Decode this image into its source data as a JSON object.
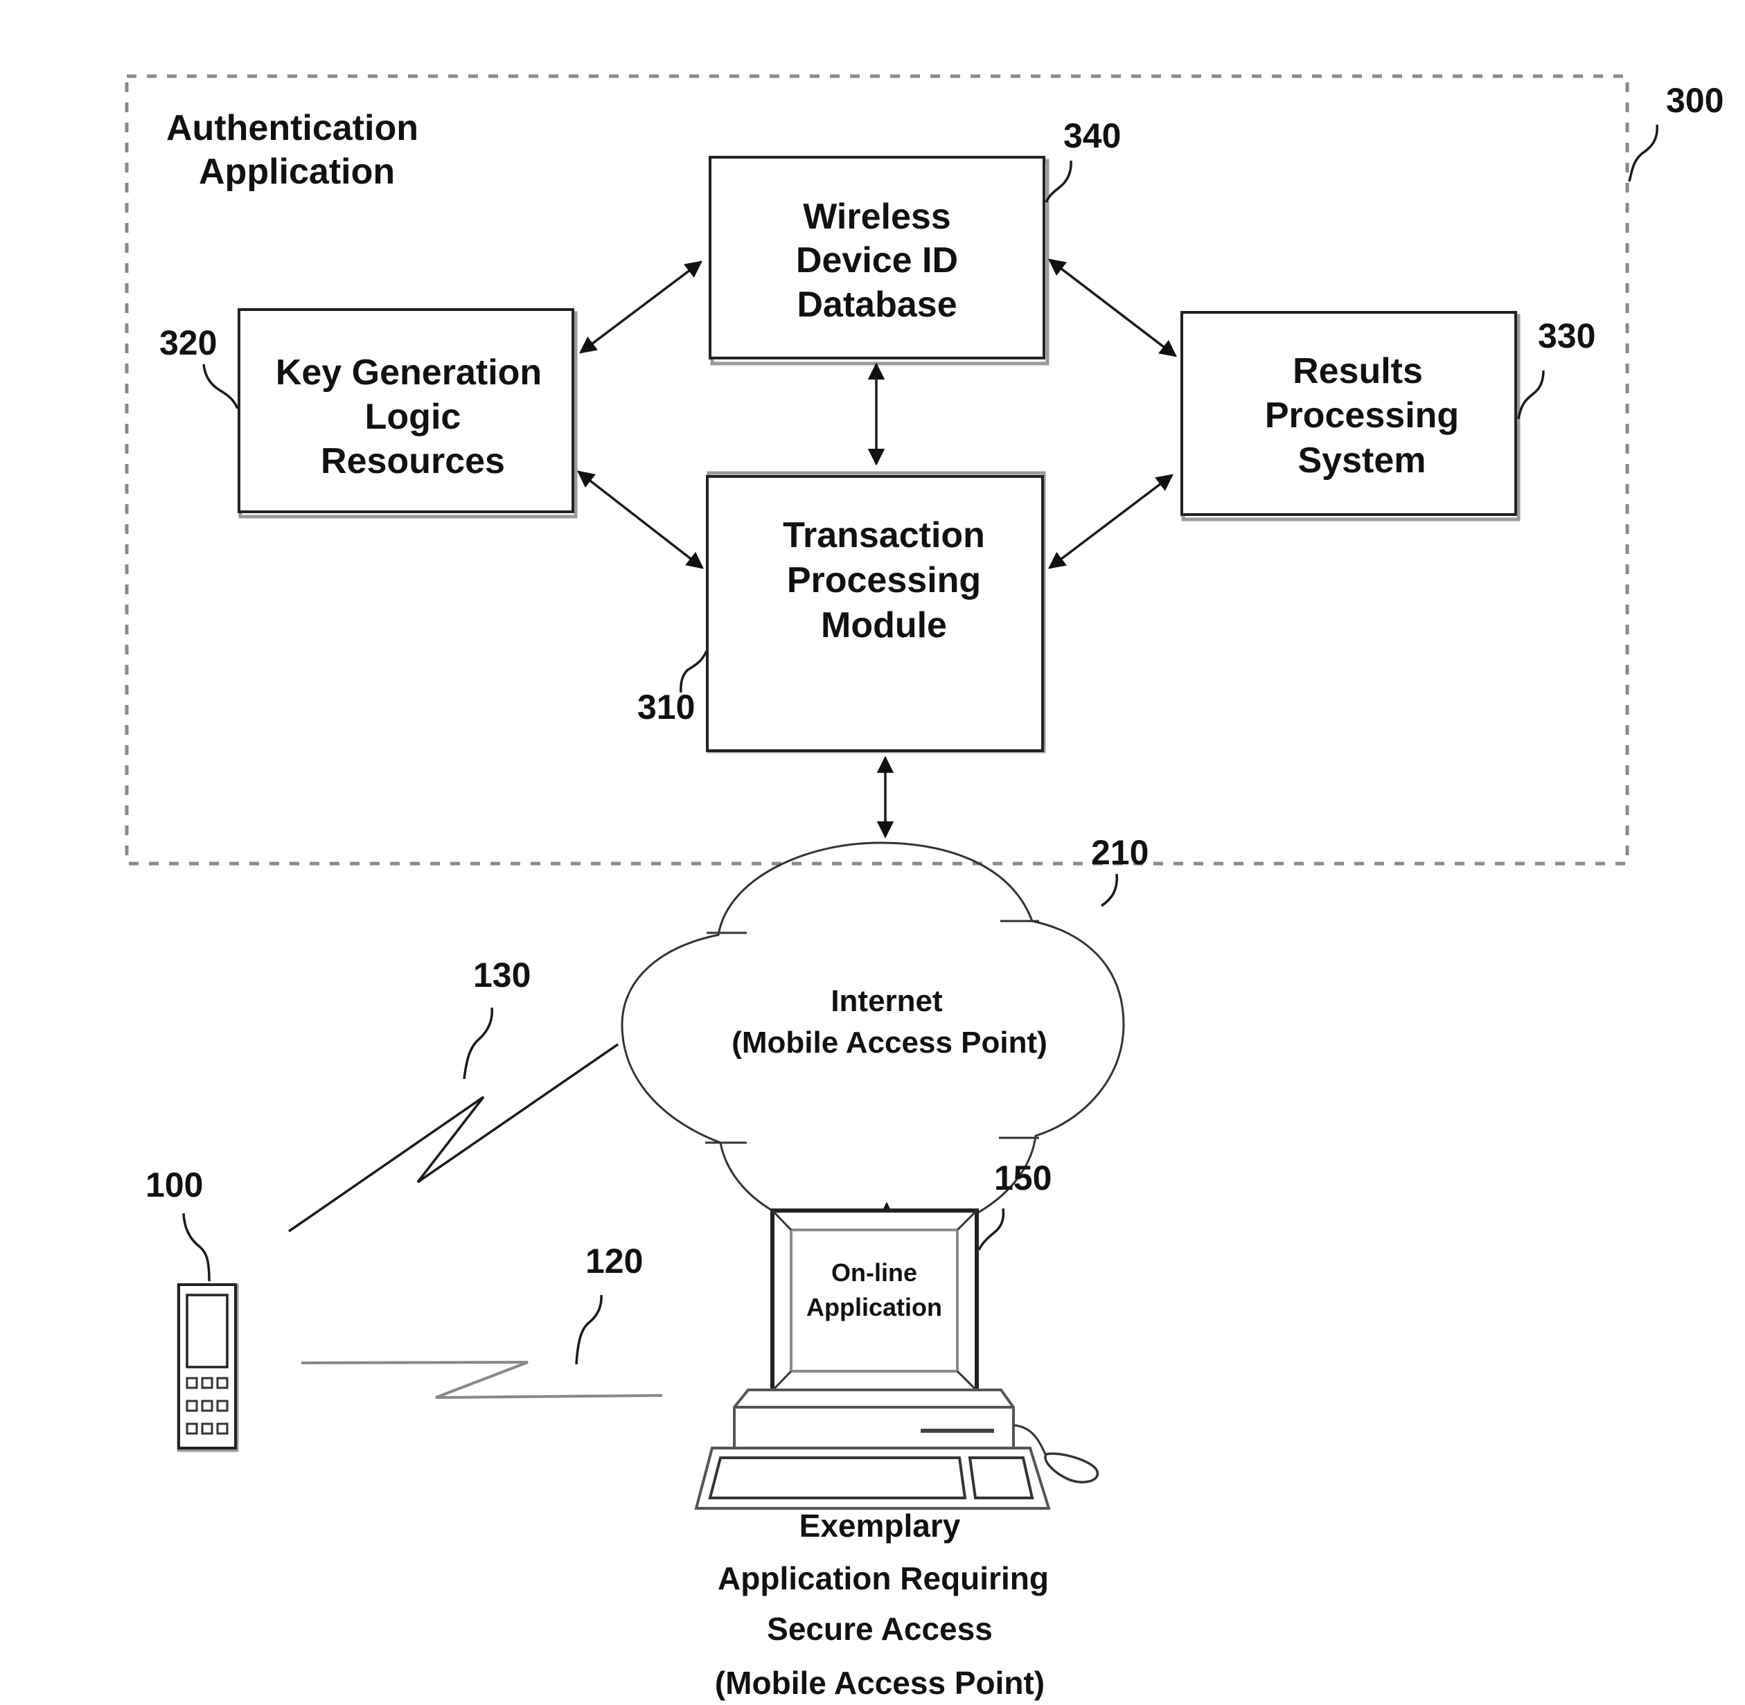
{
  "figure": {
    "container": {
      "ref": "300",
      "title_lines": [
        "Authentication",
        "Application"
      ]
    },
    "boxes": [
      {
        "id": "wireless-device-id-database",
        "ref": "340",
        "lines": [
          "Wireless",
          "Device ID",
          "Database"
        ]
      },
      {
        "id": "key-generation-logic-resources",
        "ref": "320",
        "lines": [
          "Key Generation",
          "Logic",
          "Resources"
        ]
      },
      {
        "id": "results-processing-system",
        "ref": "330",
        "lines": [
          "Results",
          "Processing",
          "System"
        ]
      },
      {
        "id": "transaction-processing-module",
        "ref": "310",
        "lines": [
          "Transaction",
          "Processing",
          "Module"
        ]
      }
    ],
    "cloud": {
      "ref": "210",
      "lines": [
        "Internet",
        "(Mobile Access Point)"
      ]
    },
    "wireless_links": [
      {
        "ref": "130"
      },
      {
        "ref": "120"
      }
    ],
    "mobile_device": {
      "ref": "100"
    },
    "computer": {
      "ref": "150",
      "screen_lines": [
        "On-line",
        "Application"
      ],
      "caption_lines": [
        "Exemplary",
        "Application Requiring",
        "Secure Access",
        "(Mobile Access Point)"
      ]
    },
    "connections": [
      {
        "from": "320",
        "to": "340",
        "bidirectional": true
      },
      {
        "from": "320",
        "to": "310",
        "bidirectional": true
      },
      {
        "from": "340",
        "to": "330",
        "bidirectional": true
      },
      {
        "from": "310",
        "to": "330",
        "bidirectional": true
      },
      {
        "from": "340",
        "to": "310",
        "bidirectional": true
      },
      {
        "from": "310",
        "to": "210",
        "bidirectional": true
      },
      {
        "from": "210",
        "to": "150",
        "bidirectional": true
      }
    ]
  }
}
